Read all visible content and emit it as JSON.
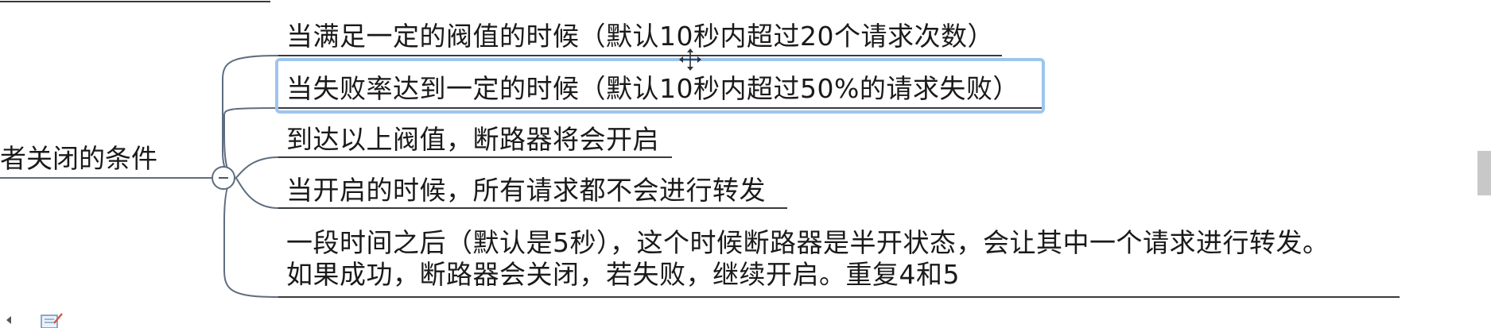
{
  "mindmap": {
    "parent_topic": "者关闭的条件",
    "children": [
      {
        "text": "当满足一定的阀值的时候（默认10秒内超过20个请求次数）"
      },
      {
        "text": "当失败率达到一定的时候（默认10秒内超过50%的请求失败）"
      },
      {
        "text": "到达以上阀值，断路器将会开启"
      },
      {
        "text": "当开启的时候，所有请求都不会进行转发"
      },
      {
        "line1": "一段时间之后（默认是5秒），这个时候断路器是半开状态，会让其中一个请求进行转发。",
        "line2": "如果成功，断路器会关闭，若失败，继续开启。重复4和5"
      }
    ]
  },
  "colors": {
    "connector": "#5e6d7e",
    "selection": "#9ec5ee",
    "text": "#1a1a1a",
    "underline": "#3a3a3a"
  },
  "icons": {
    "collapse": "minus-circle-icon",
    "move_cursor": "move-cursor-icon",
    "note": "note-edit-icon"
  }
}
